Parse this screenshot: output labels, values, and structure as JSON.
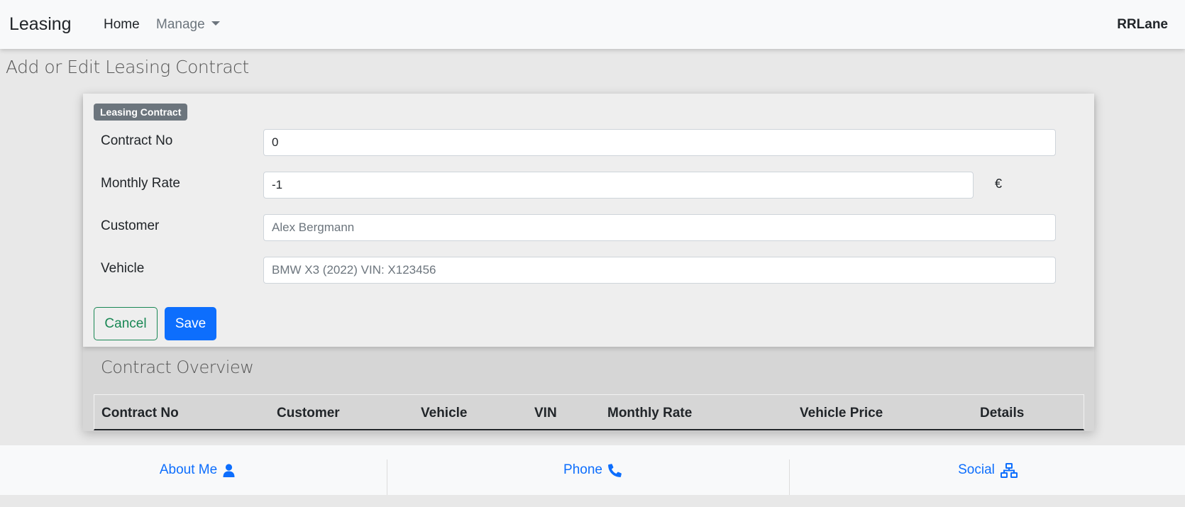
{
  "navbar": {
    "brand": "Leasing",
    "home_label": "Home",
    "manage_label": "Manage",
    "user": "RRLane"
  },
  "page": {
    "title": "Add or Edit Leasing Contract"
  },
  "form": {
    "badge": "Leasing Contract",
    "fields": [
      {
        "label": "Contract No",
        "value": "0"
      },
      {
        "label": "Monthly Rate",
        "value": "-1",
        "unit": "€"
      },
      {
        "label": "Customer",
        "value": "Alex Bergmann"
      },
      {
        "label": "Vehicle",
        "value": "BMW X3 (2022) VIN: X123456"
      }
    ],
    "cancel_label": "Cancel",
    "save_label": "Save"
  },
  "overview": {
    "title": "Contract Overview",
    "columns": [
      "Contract No",
      "Customer",
      "Vehicle",
      "VIN",
      "Monthly Rate",
      "Vehicle Price",
      "Details"
    ]
  },
  "footer": {
    "items": [
      {
        "label": "About Me",
        "icon": "user-icon"
      },
      {
        "label": "Phone",
        "icon": "phone-icon"
      },
      {
        "label": "Social",
        "icon": "network-icon"
      }
    ]
  },
  "colors": {
    "primary": "#0d6efd",
    "success": "#198754",
    "secondary": "#6c757d"
  }
}
